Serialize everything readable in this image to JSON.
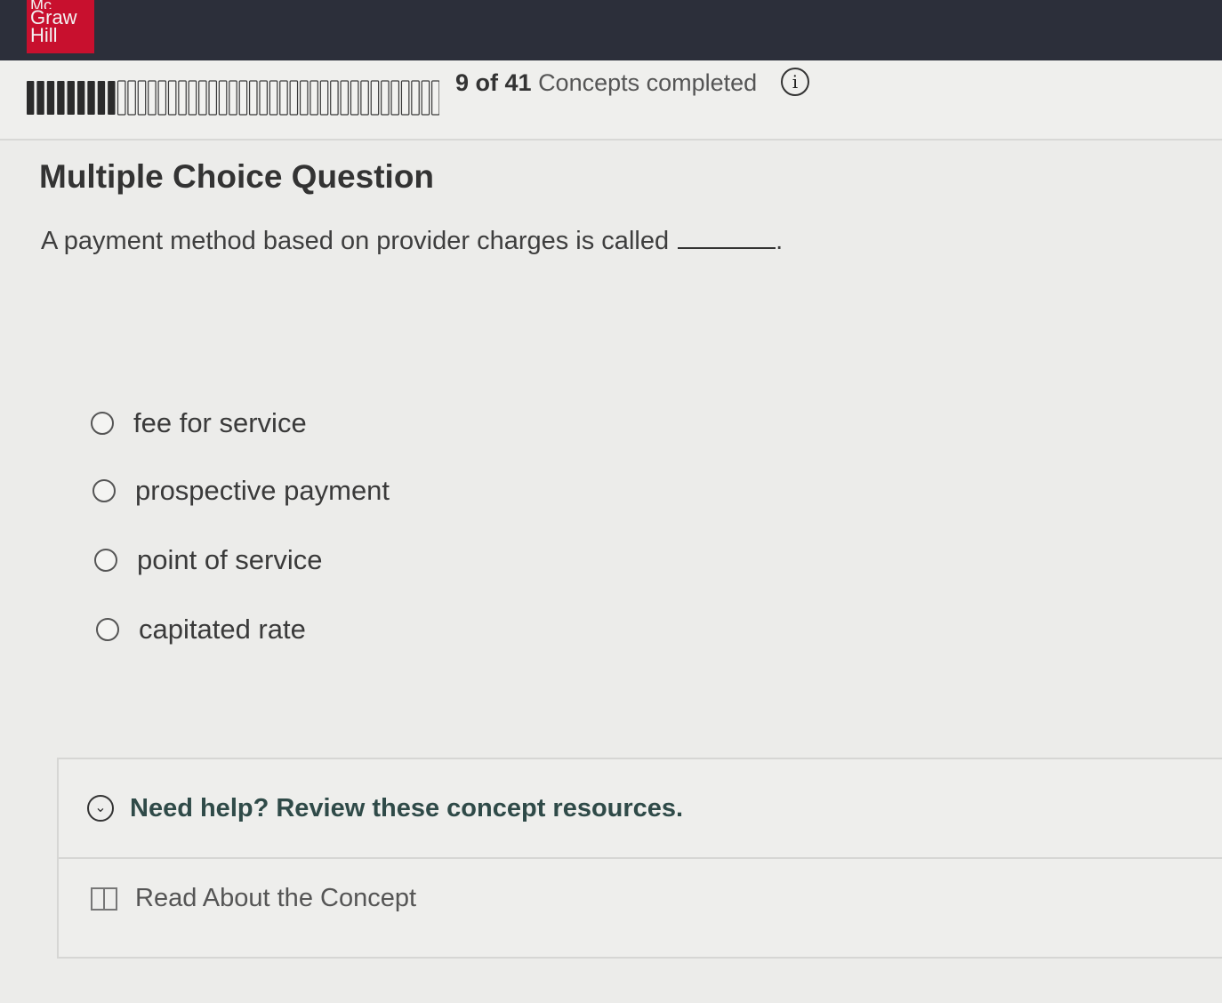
{
  "brand": {
    "logo_lines": [
      "Mc",
      "Graw",
      "Hill"
    ]
  },
  "progress": {
    "completed": 9,
    "total": 41,
    "count_text": "9 of 41",
    "suffix_text": "Concepts completed"
  },
  "question": {
    "type_label": "Multiple Choice Question",
    "prompt": "A payment method based on provider charges is called",
    "prompt_end": ".",
    "options": [
      {
        "label": "fee for service"
      },
      {
        "label": "prospective payment"
      },
      {
        "label": "point of service"
      },
      {
        "label": "capitated rate"
      }
    ]
  },
  "help": {
    "title": "Need help? Review these concept resources.",
    "resources": [
      {
        "label": "Read About the Concept",
        "icon": "book-icon"
      }
    ]
  },
  "colors": {
    "topbar": "#2c2f3a",
    "brand_red": "#c8102e",
    "help_title": "#2f4a48"
  }
}
